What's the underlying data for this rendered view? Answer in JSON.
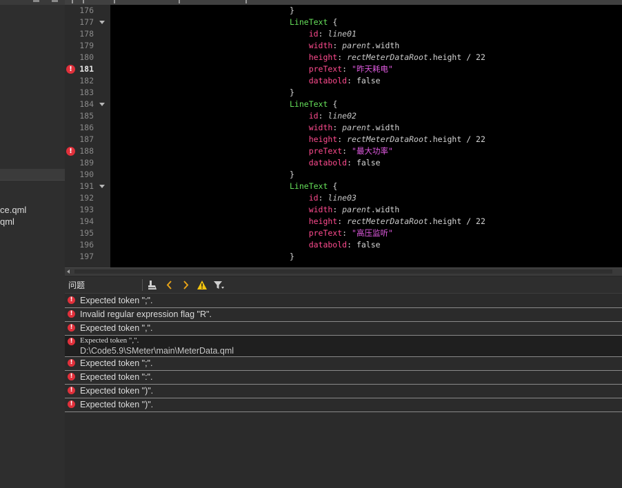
{
  "sidebar": {
    "files": [
      {
        "label": "ce.qml"
      },
      {
        "label": "qml"
      }
    ]
  },
  "editor": {
    "lines": [
      {
        "n": "176",
        "fold": false,
        "bp": false,
        "tokens": [
          {
            "t": "}",
            "c": "punc"
          }
        ]
      },
      {
        "n": "177",
        "fold": true,
        "bp": false,
        "tokens": [
          {
            "t": "LineText",
            "c": "type"
          },
          {
            "t": " {",
            "c": "punc"
          }
        ]
      },
      {
        "n": "178",
        "fold": false,
        "bp": false,
        "tokens": [
          {
            "t": "    id",
            "c": "prop"
          },
          {
            "t": ": ",
            "c": "punc"
          },
          {
            "t": "line01",
            "c": "it"
          }
        ]
      },
      {
        "n": "179",
        "fold": false,
        "bp": false,
        "tokens": [
          {
            "t": "    width",
            "c": "prop"
          },
          {
            "t": ": ",
            "c": "punc"
          },
          {
            "t": "parent",
            "c": "it"
          },
          {
            "t": ".width",
            "c": "plain"
          }
        ]
      },
      {
        "n": "180",
        "fold": false,
        "bp": false,
        "tokens": [
          {
            "t": "    height",
            "c": "prop"
          },
          {
            "t": ": ",
            "c": "punc"
          },
          {
            "t": "rectMeterDataRoot",
            "c": "it"
          },
          {
            "t": ".height / 22",
            "c": "plain"
          }
        ]
      },
      {
        "n": "181",
        "fold": false,
        "bp": true,
        "active": true,
        "tokens": [
          {
            "t": "    preText",
            "c": "prop"
          },
          {
            "t": ": ",
            "c": "punc"
          },
          {
            "t": "\"昨天耗电\"",
            "c": "str"
          }
        ]
      },
      {
        "n": "182",
        "fold": false,
        "bp": false,
        "tokens": [
          {
            "t": "    databold",
            "c": "prop"
          },
          {
            "t": ": ",
            "c": "punc"
          },
          {
            "t": "false",
            "c": "kw"
          }
        ]
      },
      {
        "n": "183",
        "fold": false,
        "bp": false,
        "tokens": [
          {
            "t": "}",
            "c": "punc"
          }
        ]
      },
      {
        "n": "184",
        "fold": true,
        "bp": false,
        "tokens": [
          {
            "t": "LineText",
            "c": "type"
          },
          {
            "t": " {",
            "c": "punc"
          }
        ]
      },
      {
        "n": "185",
        "fold": false,
        "bp": false,
        "tokens": [
          {
            "t": "    id",
            "c": "prop"
          },
          {
            "t": ": ",
            "c": "punc"
          },
          {
            "t": "line02",
            "c": "it"
          }
        ]
      },
      {
        "n": "186",
        "fold": false,
        "bp": false,
        "tokens": [
          {
            "t": "    width",
            "c": "prop"
          },
          {
            "t": ": ",
            "c": "punc"
          },
          {
            "t": "parent",
            "c": "it"
          },
          {
            "t": ".width",
            "c": "plain"
          }
        ]
      },
      {
        "n": "187",
        "fold": false,
        "bp": false,
        "tokens": [
          {
            "t": "    height",
            "c": "prop"
          },
          {
            "t": ": ",
            "c": "punc"
          },
          {
            "t": "rectMeterDataRoot",
            "c": "it"
          },
          {
            "t": ".height / 22",
            "c": "plain"
          }
        ]
      },
      {
        "n": "188",
        "fold": false,
        "bp": true,
        "tokens": [
          {
            "t": "    preText",
            "c": "prop"
          },
          {
            "t": ": ",
            "c": "punc"
          },
          {
            "t": "\"最大功率\"",
            "c": "str"
          }
        ]
      },
      {
        "n": "189",
        "fold": false,
        "bp": false,
        "tokens": [
          {
            "t": "    databold",
            "c": "prop"
          },
          {
            "t": ": ",
            "c": "punc"
          },
          {
            "t": "false",
            "c": "kw"
          }
        ]
      },
      {
        "n": "190",
        "fold": false,
        "bp": false,
        "tokens": [
          {
            "t": "}",
            "c": "punc"
          }
        ]
      },
      {
        "n": "191",
        "fold": true,
        "bp": false,
        "tokens": [
          {
            "t": "LineText",
            "c": "type"
          },
          {
            "t": " {",
            "c": "punc"
          }
        ]
      },
      {
        "n": "192",
        "fold": false,
        "bp": false,
        "tokens": [
          {
            "t": "    id",
            "c": "prop"
          },
          {
            "t": ": ",
            "c": "punc"
          },
          {
            "t": "line03",
            "c": "it"
          }
        ]
      },
      {
        "n": "193",
        "fold": false,
        "bp": false,
        "tokens": [
          {
            "t": "    width",
            "c": "prop"
          },
          {
            "t": ": ",
            "c": "punc"
          },
          {
            "t": "parent",
            "c": "it"
          },
          {
            "t": ".width",
            "c": "plain"
          }
        ]
      },
      {
        "n": "194",
        "fold": false,
        "bp": false,
        "tokens": [
          {
            "t": "    height",
            "c": "prop"
          },
          {
            "t": ": ",
            "c": "punc"
          },
          {
            "t": "rectMeterDataRoot",
            "c": "it"
          },
          {
            "t": ".height / 22",
            "c": "plain"
          }
        ]
      },
      {
        "n": "195",
        "fold": false,
        "bp": false,
        "tokens": [
          {
            "t": "    preText",
            "c": "prop"
          },
          {
            "t": ": ",
            "c": "punc"
          },
          {
            "t": "\"高压监听\"",
            "c": "str"
          }
        ]
      },
      {
        "n": "196",
        "fold": false,
        "bp": false,
        "tokens": [
          {
            "t": "    databold",
            "c": "prop"
          },
          {
            "t": ": ",
            "c": "punc"
          },
          {
            "t": "false",
            "c": "kw"
          }
        ]
      },
      {
        "n": "197",
        "fold": false,
        "bp": false,
        "tokens": [
          {
            "t": "}",
            "c": "punc"
          }
        ]
      }
    ]
  },
  "issues_panel": {
    "title": "问题",
    "toolbar_icons": [
      "clean-icon",
      "previous-icon",
      "next-icon",
      "warning-icon",
      "filter-icon"
    ],
    "items": [
      {
        "message": "Expected token \";\".",
        "path": ""
      },
      {
        "message": "Invalid regular expression flag \"R\".",
        "path": ""
      },
      {
        "message": "Expected token \",\".",
        "path": ""
      },
      {
        "message": "Expected token \",\".",
        "path": "D:\\Code5.9\\SMeter\\main\\MeterData.qml",
        "selected": true
      },
      {
        "message": "Expected token \";\".",
        "path": ""
      },
      {
        "message": "Expected token \":\".",
        "path": ""
      },
      {
        "message": "Expected token \")\".",
        "path": ""
      },
      {
        "message": "Expected token \")\".",
        "path": ""
      }
    ]
  },
  "colors": {
    "error": "#e0303b",
    "type": "#66e05a",
    "property": "#ff4b8f",
    "string": "#e05ae0"
  }
}
